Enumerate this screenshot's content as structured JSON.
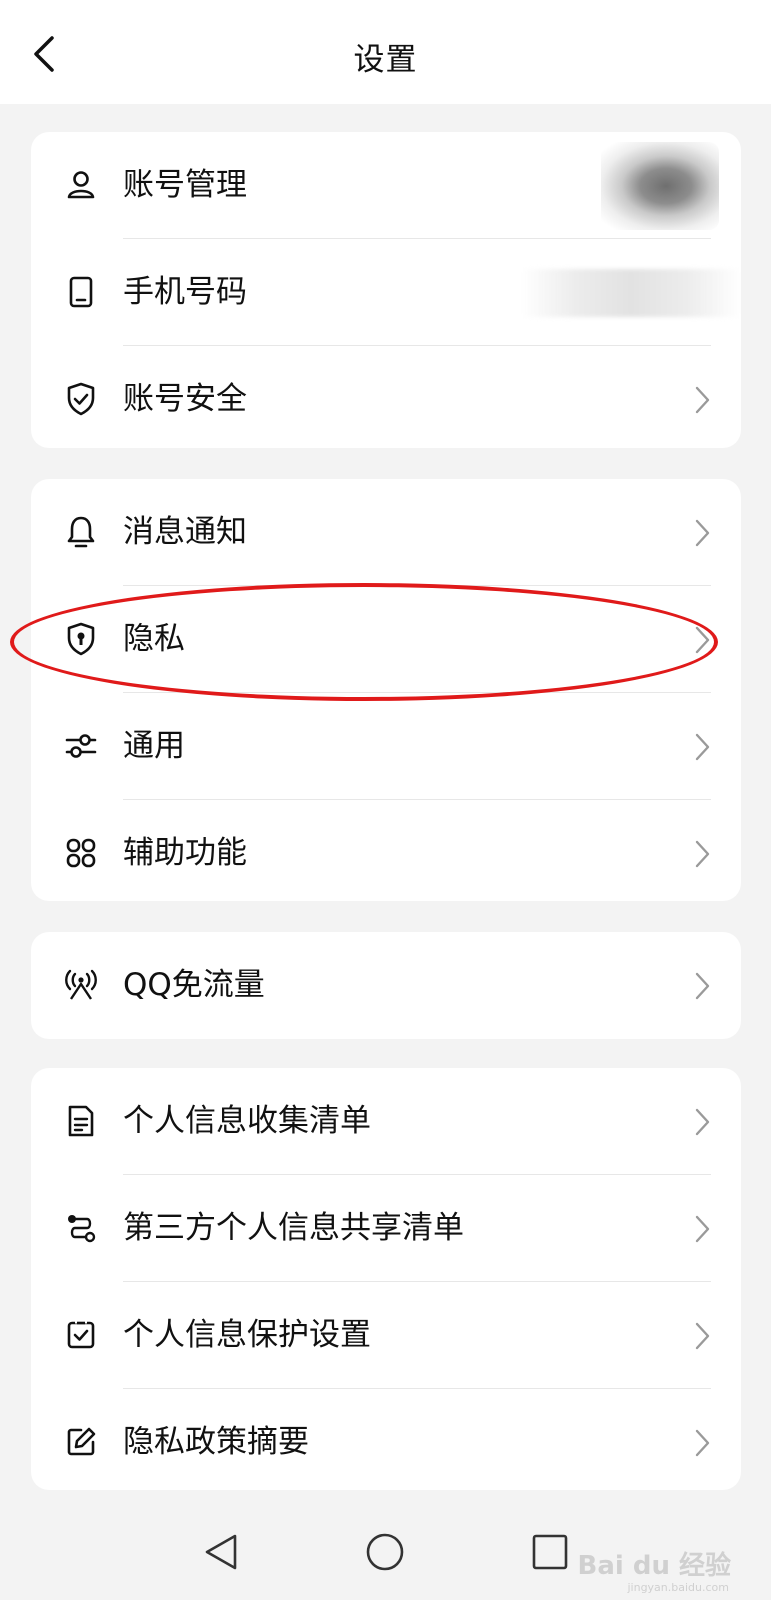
{
  "header": {
    "title": "设置"
  },
  "groups": [
    {
      "items": [
        {
          "label": "账号管理",
          "icon": "user-icon"
        },
        {
          "label": "手机号码",
          "icon": "phone-icon"
        },
        {
          "label": "账号安全",
          "icon": "shield-check-icon"
        }
      ]
    },
    {
      "items": [
        {
          "label": "消息通知",
          "icon": "bell-icon"
        },
        {
          "label": "隐私",
          "icon": "shield-lock-icon"
        },
        {
          "label": "通用",
          "icon": "sliders-icon"
        },
        {
          "label": "辅助功能",
          "icon": "command-icon"
        }
      ]
    },
    {
      "items": [
        {
          "label": "QQ免流量",
          "icon": "signal-tower-icon"
        }
      ]
    },
    {
      "items": [
        {
          "label": "个人信息收集清单",
          "icon": "document-icon"
        },
        {
          "label": "第三方个人信息共享清单",
          "icon": "share-flow-icon"
        },
        {
          "label": "个人信息保护设置",
          "icon": "checkbox-icon"
        },
        {
          "label": "隐私政策摘要",
          "icon": "edit-icon"
        }
      ]
    }
  ],
  "watermark": {
    "text": "Bai du 经验",
    "sub": "jingyan.baidu.com"
  },
  "colors": {
    "highlight": "#e01a1a",
    "background": "#f3f3f3",
    "card": "#ffffff"
  }
}
